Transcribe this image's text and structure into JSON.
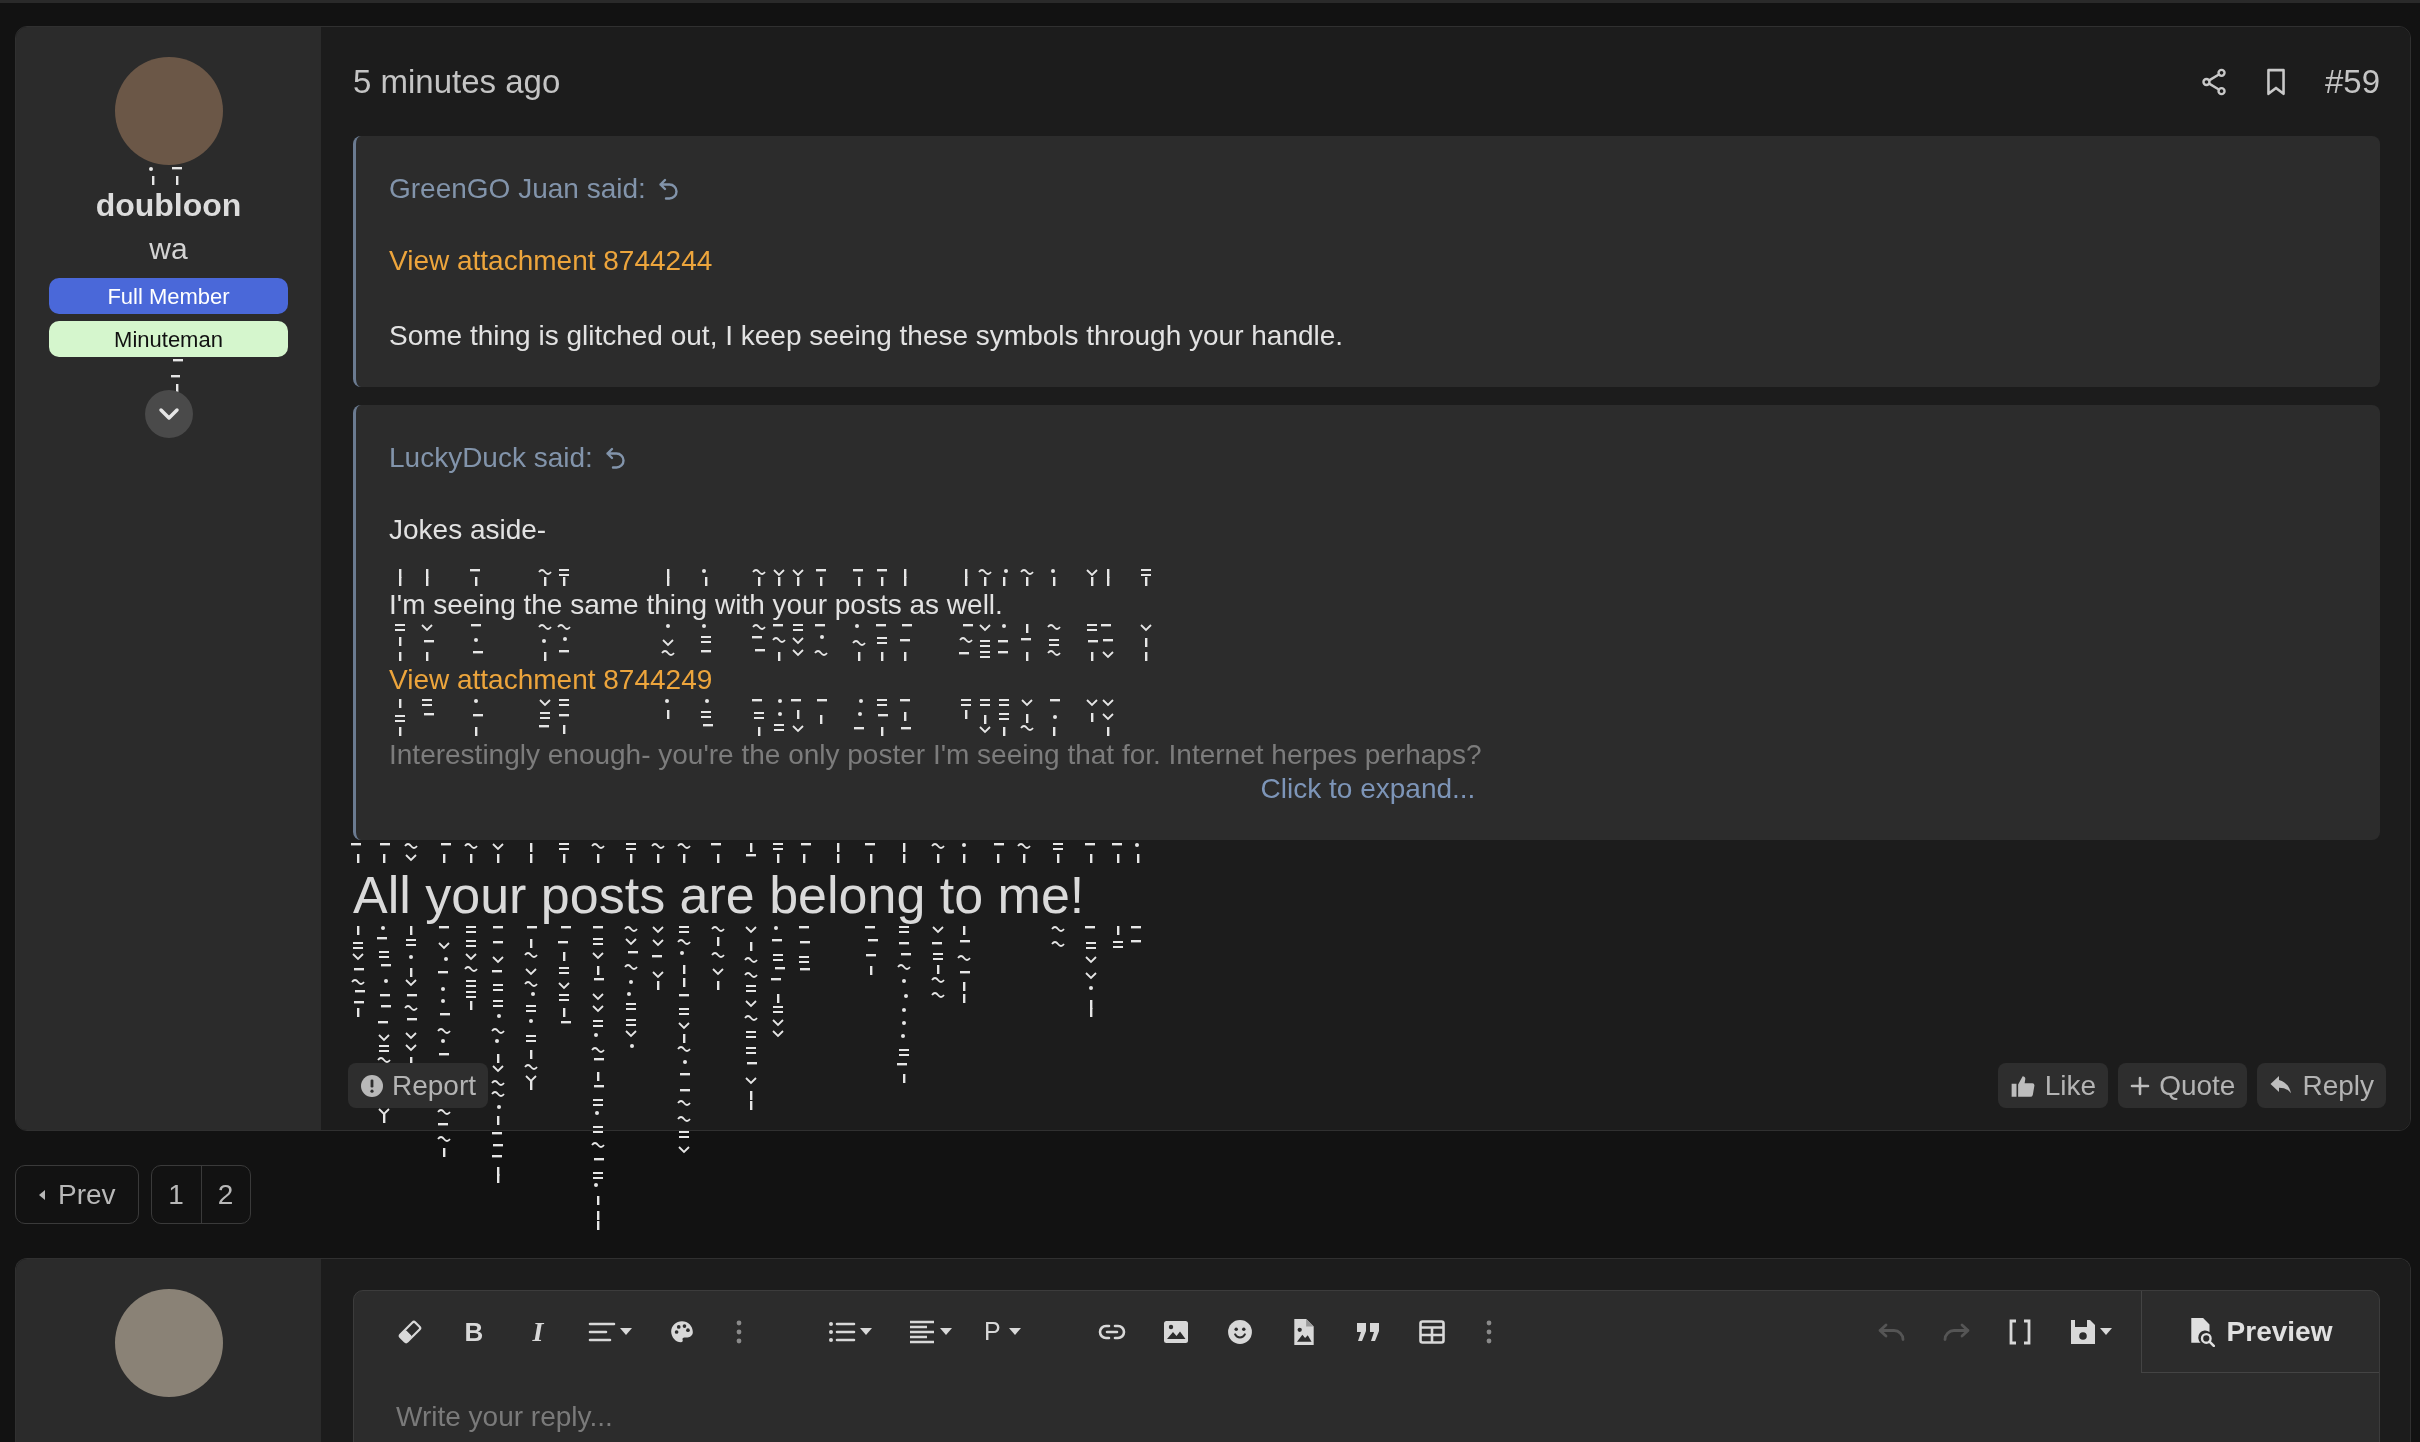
{
  "author": {
    "name": "doubloon",
    "title": "wa",
    "badges": [
      {
        "label": "Full Member",
        "color": "#4a68d9"
      },
      {
        "label": "Minuteman",
        "color": "#d5f6cd"
      }
    ]
  },
  "post": {
    "time": "5 minutes ago",
    "number": "#59",
    "quotes": [
      {
        "attribution": "GreenGO Juan said:",
        "paragraphs": [
          {
            "kind": "link",
            "text": "View attachment 8744244"
          },
          {
            "kind": "text",
            "text": "Some thing is glitched out, I keep seeing these symbols through your handle."
          }
        ]
      },
      {
        "attribution": "LuckyDuck said:",
        "paragraphs": [
          {
            "kind": "text",
            "text": "Jokes aside-"
          },
          {
            "kind": "text",
            "text": "I'm seeing the same thing with your posts as well."
          },
          {
            "kind": "link",
            "text": "View attachment 8744249"
          },
          {
            "kind": "faded",
            "text": "Interestingly enough- you're the only poster I'm seeing that for. Internet herpes perhaps?"
          }
        ],
        "expand": "Click to expand..."
      }
    ],
    "body": "All your posts are belong to me!",
    "actions_left": [
      "Report"
    ],
    "actions_right": [
      "Like",
      "Quote",
      "Reply"
    ]
  },
  "pagination": {
    "prev": "Prev",
    "pages": [
      "1",
      "2"
    ]
  },
  "reply": {
    "toolbar": {
      "bold": "B",
      "italic": "I",
      "paragraph": "P",
      "undo": {
        "disabled": true
      },
      "redo": {
        "disabled": true
      }
    },
    "preview": "Preview",
    "placeholder": "Write your reply..."
  }
}
